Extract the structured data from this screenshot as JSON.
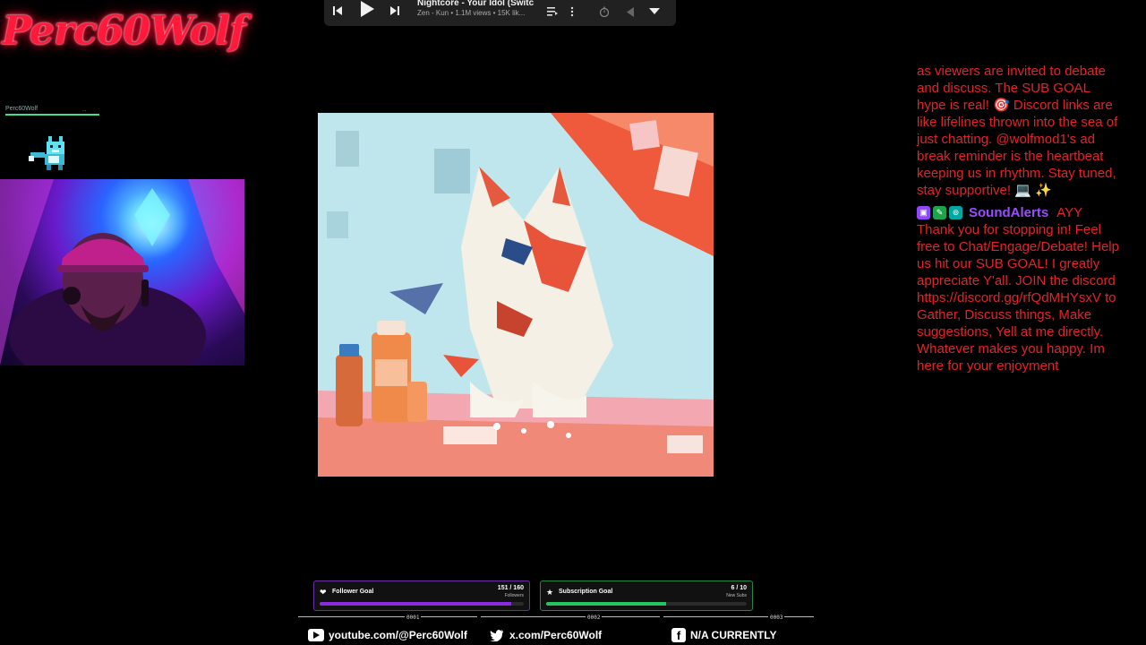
{
  "branding": {
    "channel_logo": "Perc60Wolf"
  },
  "player": {
    "title": "Nightcore - Your Idol (Switchin...",
    "subtitle": "Zen - Kun • 1.1M views • 15K lik...",
    "icons": [
      "skip-previous-icon",
      "play-icon",
      "skip-next-icon",
      "queue-icon",
      "more-icon",
      "timer-icon",
      "volume-icon",
      "chevron-down-icon"
    ]
  },
  "viewer_bar": {
    "name": "Perc60Wolf",
    "right_label": "...",
    "progress": 1.0
  },
  "chat": {
    "messages": [
      {
        "text_lines": "as viewers are invited to debate and discuss. The SUB GOAL hype is real! 🎯 Discord links are like lifelines thrown into the sea of just chatting. @wolfmod1's ad break reminder is the heartbeat keeping us in rhythm. Stay tuned, stay supportive! 💻 ✨"
      },
      {
        "author": "SoundAlerts",
        "author_prefix": "AYY",
        "text": "Thank you for stopping in! Feel free to Chat/Engage/Debate! Help us hit our SUB GOAL! I greatly appreciate Y'all. JOIN the discord https://discord.gg/rfQdMHYsxV to Gather, Discuss things, Make suggestions, Yell at me directly. Whatever makes you happy. Im here for your enjoyment"
      }
    ],
    "colors": {
      "text": "#e8202a",
      "author": "#9b4dff"
    }
  },
  "goals": {
    "follower": {
      "label": "Follower Goal",
      "value": "151 / 160",
      "unit": "Followers",
      "progress": 0.94,
      "color": "#8a2be2"
    },
    "subscription": {
      "label": "Subscription Goal",
      "value": "6 / 10",
      "unit": "New Subs",
      "progress": 0.6,
      "color": "#22c55e"
    }
  },
  "socials": [
    {
      "num": "0001",
      "icon": "youtube-icon",
      "label": "youtube.com/@Perc60Wolf"
    },
    {
      "num": "0002",
      "icon": "twitter-icon",
      "label": "x.com/Perc60Wolf"
    },
    {
      "num": "0003",
      "icon": "facebook-icon",
      "label": "N/A CURRENTLY"
    }
  ]
}
